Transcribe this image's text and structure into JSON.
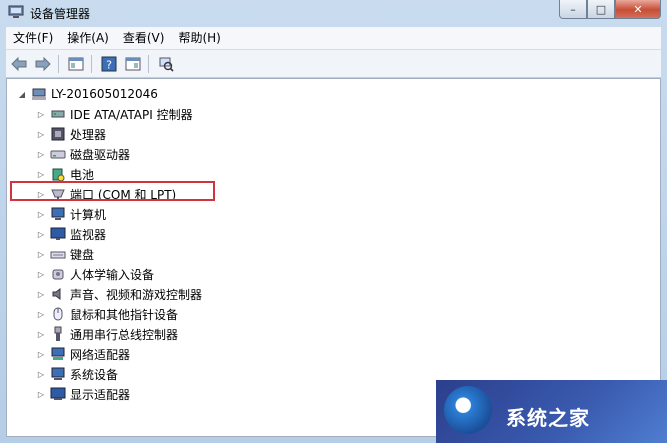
{
  "window": {
    "title": "设备管理器"
  },
  "window_buttons": {
    "minimize": "–",
    "maximize": "□",
    "close": "✕"
  },
  "menu": [
    "文件(F)",
    "操作(A)",
    "查看(V)",
    "帮助(H)"
  ],
  "tree": {
    "root": "LY-201605012046",
    "items": [
      {
        "label": "IDE ATA/ATAPI 控制器",
        "icon": "ide-controller-icon"
      },
      {
        "label": "处理器",
        "icon": "processor-icon"
      },
      {
        "label": "磁盘驱动器",
        "icon": "disk-drive-icon"
      },
      {
        "label": "电池",
        "icon": "battery-icon"
      },
      {
        "label": "端口 (COM 和 LPT)",
        "icon": "port-icon"
      },
      {
        "label": "计算机",
        "icon": "computer-icon"
      },
      {
        "label": "监视器",
        "icon": "monitor-icon"
      },
      {
        "label": "键盘",
        "icon": "keyboard-icon"
      },
      {
        "label": "人体学输入设备",
        "icon": "hid-icon"
      },
      {
        "label": "声音、视频和游戏控制器",
        "icon": "sound-icon"
      },
      {
        "label": "鼠标和其他指针设备",
        "icon": "mouse-icon"
      },
      {
        "label": "通用串行总线控制器",
        "icon": "usb-icon"
      },
      {
        "label": "网络适配器",
        "icon": "network-adapter-icon"
      },
      {
        "label": "系统设备",
        "icon": "system-device-icon"
      },
      {
        "label": "显示适配器",
        "icon": "display-adapter-icon"
      }
    ],
    "highlighted_index": 4
  },
  "watermark": {
    "text": "系统之家"
  },
  "colors": {
    "highlight_border": "#d0343d",
    "chrome": "#b5cde6"
  }
}
